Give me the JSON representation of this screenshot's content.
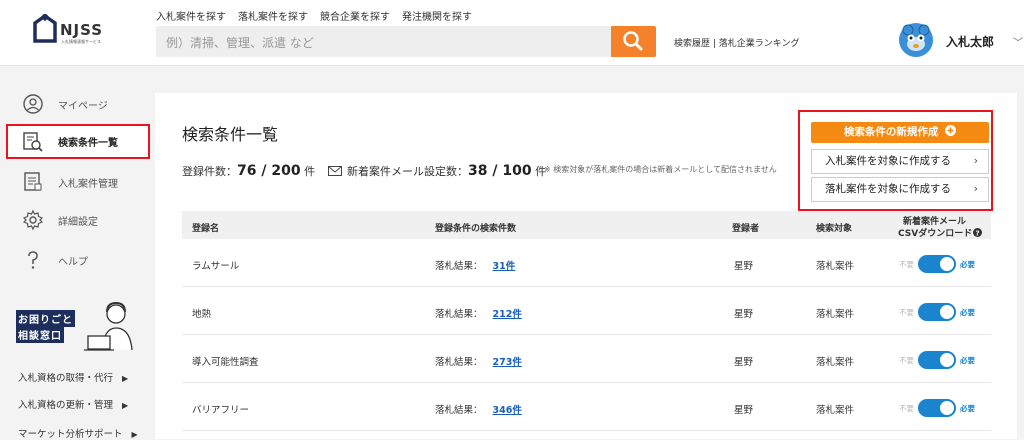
{
  "header": {
    "logo_name": "NJSS",
    "logo_sub": "入札情報速報サービス",
    "nav": [
      "入札案件を探す",
      "落札案件を探す",
      "競合企業を探す",
      "発注機関を探す"
    ],
    "search_placeholder": "例）清掃、管理、派遣 など",
    "links": "検索履歴 | 落札企業ランキング",
    "user_name": "入札太郎",
    "brand_color": "#f5822a"
  },
  "sidebar": {
    "items": [
      {
        "label": "マイページ",
        "icon": "smiley-icon"
      },
      {
        "label": "検索条件一覧",
        "icon": "search-list-icon"
      },
      {
        "label": "入札案件管理",
        "icon": "document-icon"
      },
      {
        "label": "詳細設定",
        "icon": "gear-icon"
      },
      {
        "label": "ヘルプ",
        "icon": "question-icon"
      }
    ],
    "help_title_1": "お困りごと",
    "help_title_2": "相談窓口",
    "sublinks": [
      "入札資格の取得・代行",
      "入札資格の更新・管理",
      "マーケット分析サポート"
    ]
  },
  "main": {
    "title": "検索条件一覧",
    "count_label": "登録件数：",
    "count_value": "76 / 200",
    "count_unit": "件",
    "mail_label": "新着案件メール設定数：",
    "mail_value": "38 / 100",
    "mail_unit": "件",
    "note": "※ 検索対象が落札案件の場合は新着メールとして配信されません",
    "new_button": "検索条件の新規作成",
    "option_1": "入札案件を対象に作成する",
    "option_2": "落札案件を対象に作成する",
    "columns": [
      "登録名",
      "登録条件の検索件数",
      "登録者",
      "検索対象",
      "新着案件メール",
      "CSVダウンロード"
    ],
    "rows": [
      {
        "name": "ラムサール",
        "result_label": "落札結果：",
        "result_count": "31件",
        "user": "星野",
        "target": "落札案件",
        "off": "不要",
        "on": "必要"
      },
      {
        "name": "地熱",
        "result_label": "落札結果：",
        "result_count": "212件",
        "user": "星野",
        "target": "落札案件",
        "off": "不要",
        "on": "必要"
      },
      {
        "name": "導入可能性調査",
        "result_label": "落札結果：",
        "result_count": "273件",
        "user": "星野",
        "target": "落札案件",
        "off": "不要",
        "on": "必要"
      },
      {
        "name": "バリアフリー",
        "result_label": "落札結果：",
        "result_count": "346件",
        "user": "星野",
        "target": "落札案件",
        "off": "不要",
        "on": "必要"
      }
    ],
    "accent_color": "#1a84cf",
    "highlight_color": "#e8161c"
  }
}
